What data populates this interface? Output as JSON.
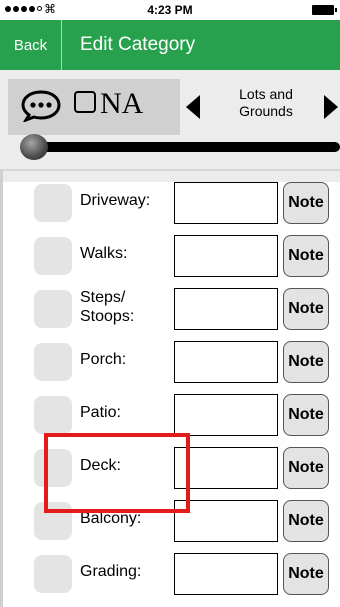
{
  "status_bar": {
    "time": "4:23 PM",
    "wifi_icon": "wifi-icon",
    "battery_icon": "battery-icon"
  },
  "nav": {
    "back_label": "Back",
    "title": "Edit Category"
  },
  "controls": {
    "comment_icon": "speech-bubble-icon",
    "na_label": "NA",
    "category_name": "Lots and Grounds",
    "slider_value": 0
  },
  "items": [
    {
      "label": "Driveway:",
      "note_label": "Note"
    },
    {
      "label": "Walks:",
      "note_label": "Note"
    },
    {
      "label": "Steps/ Stoops:",
      "note_label": "Note"
    },
    {
      "label": "Porch:",
      "note_label": "Note"
    },
    {
      "label": "Patio:",
      "note_label": "Note"
    },
    {
      "label": "Deck:",
      "note_label": "Note"
    },
    {
      "label": "Balcony:",
      "note_label": "Note"
    },
    {
      "label": "Grading:",
      "note_label": "Note"
    }
  ],
  "colors": {
    "nav_green": "#27a14e",
    "highlight_red": "#e41b1b"
  }
}
